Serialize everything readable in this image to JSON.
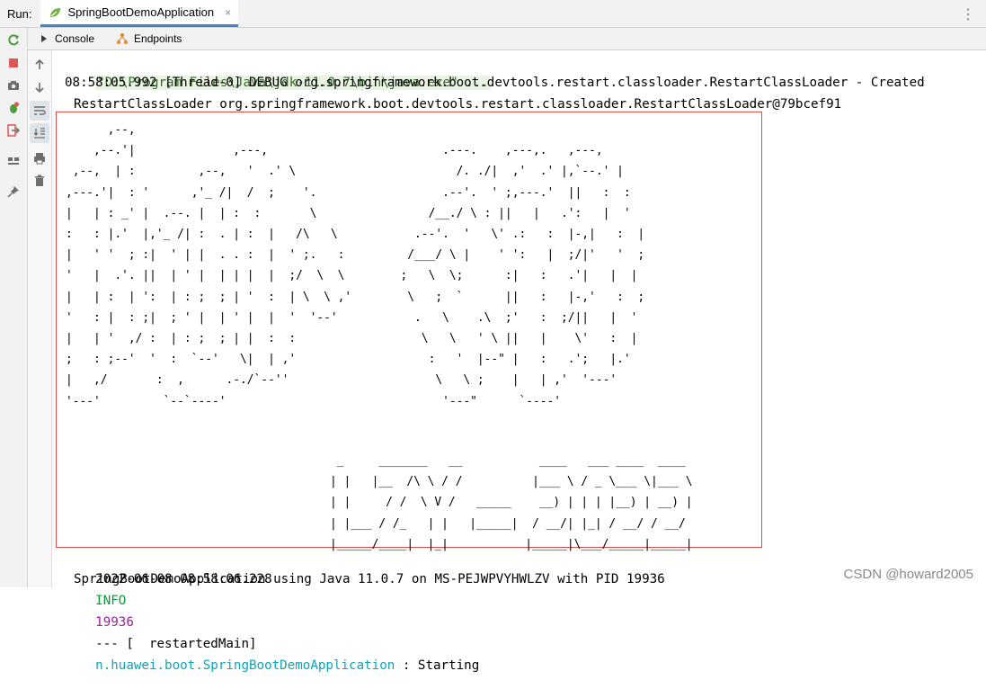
{
  "run_bar": {
    "label": "Run:",
    "tab_label": "SpringBootDemoApplication",
    "close_symbol": "×"
  },
  "sub_tabs": [
    {
      "label": "Console",
      "icon": "console-icon"
    },
    {
      "label": "Endpoints",
      "icon": "endpoints-icon"
    }
  ],
  "console": {
    "command_line": "\"D:\\Program Files\\Java\\jdk-11.0.7\\bin\\java.exe\" ...",
    "debug_line_1": "08:58:05.992 [Thread-0] DEBUG org.springframework.boot.devtools.restart.classloader.RestartClassLoader - Created",
    "debug_line_2": "RestartClassLoader org.springframework.boot.devtools.restart.classloader.RestartClassLoader@79bcef91",
    "banner_art_top": "      ,--,\n    ,--.'|              ,---,                         .---.    ,---,.   ,---,\n ,--,  | :         ,--,   '  .' \\                       /. ./|  ,'  .' |,`--.' |\n,---.'|  : '      ,'_ /|  /  ;    '.                  .--'.  ' ;,---.'  ||   :  :\n|   | : _' |  .--. |  | :  :       \\                /__./ \\ : ||   |   .':   |  '\n:   : |.'  |,'_ /| :  . | :  |   /\\   \\           .--'.  '   \\' .:   :  |-,|   :  |\n|   ' '  ; :|  ' | |  . . :  |  ' ;.   :         /___/ \\ |    ' ':   |  ;/|'   '  ;\n'   |  .'. ||  | ' |  | | |  |  ;/  \\  \\        ;   \\  \\;      :|   :   .'|   |  |\n|   | :  | ':  | : ;  ; | '  :  | \\  \\ ,'        \\   ;  `      ||   :   |-,'   :  ;\n'   : |  : ;|  ; ' |  | ' |  |  '  '--'           .   \\    .\\  ;'   :  ;/||   |  '\n|   | '  ,/ :  | : ;  ; | |  :  :                  \\   \\   ' \\ ||   |    \\'   :  |\n;   : ;--'  '  :  `--'   \\|  | ,'                   :   '  |--\" |   :   .';   |.'\n|   ,/       :  ,      .-./`--''                     \\   \\ ;    |   | ,'  '---'\n'---'         `--`----'                               '---\"      `----'",
    "banner_art_bottom": " _     _______   __           ____   ___ ____  ____\n| |   |__  /\\ \\ / /          |___ \\ / _ \\___ \\|___ \\\n| |     / /  \\ V /   _____    __) | | | |__) | __) |\n| |___ / /_   | |   |_____|  / __/| |_| / __/ / __/\n|_____/____|  |_|           |_____|\\___/_____|_____|",
    "log_timestamp": "2022-06-08 08:58:06.228",
    "log_level": "INFO",
    "log_pid": "19936",
    "log_thread": "--- [  restartedMain]",
    "log_logger": "n.huawei.boot.SpringBootDemoApplication",
    "log_message": " : Starting",
    "log_continuation": "SpringBootDemoApplication using Java 11.0.7 on MS-PEJWPVYHWLZV with PID 19936"
  },
  "watermark": "CSDN @howard2005",
  "colors": {
    "info": "#0a9b3a",
    "pid": "#9b1fa0",
    "logger": "#12a3b7",
    "banner_border": "#e04a4a",
    "command_bg": "#eaf3e4"
  }
}
